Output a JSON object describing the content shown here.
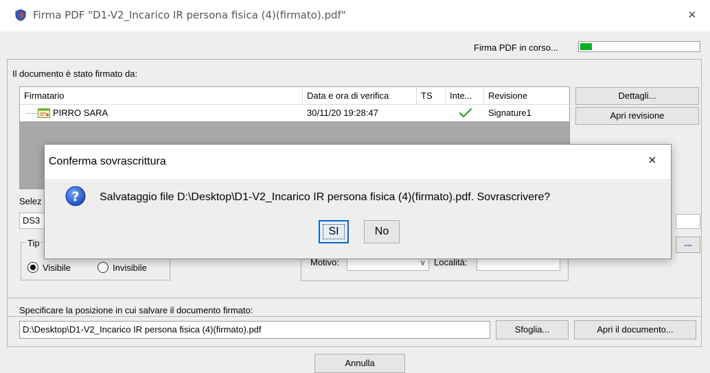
{
  "window": {
    "title": "Firma PDF \"D1-V2_Incarico IR persona fisica (4)(firmato).pdf\"",
    "close_glyph": "×",
    "app_icon": "shield-icon"
  },
  "progress": {
    "label": "Firma PDF in corso...",
    "value_fraction": 0.1,
    "color": "#06b025"
  },
  "signers": {
    "group_label": "Il documento è stato firmato da:",
    "columns": [
      "Firmatario",
      "Data e ora di verifica",
      "TS",
      "Inte...",
      "Revisione"
    ],
    "rows": [
      {
        "signer": "PIRRO SARA",
        "verified_at": "30/11/20 19:28:47",
        "ts": "",
        "integrity": "check-icon",
        "revision": "Signature1"
      }
    ],
    "details_button": "Dettagli...",
    "open_revision_button": "Apri revisione"
  },
  "selection": {
    "label_partial": "Selez",
    "value_partial": "DS3",
    "side_button": "..."
  },
  "signature_type": {
    "label_partial": "Tip",
    "options": [
      "Visibile",
      "Invisibile"
    ],
    "selected": "Visibile"
  },
  "reason": {
    "motivo_label": "Motivo:",
    "localita_label": "Località:"
  },
  "save": {
    "label": "Specificare la posizione in cui salvare il documento firmato:",
    "path": "D:\\Desktop\\D1-V2_Incarico IR persona fisica (4)(firmato).pdf",
    "browse_button": "Sfoglia...",
    "open_button": "Apri il documento...",
    "cancel_button": "Annulla"
  },
  "dialog": {
    "title": "Conferma sovrascrittura",
    "close_glyph": "×",
    "icon": "question-icon",
    "message": "Salvataggio file D:\\Desktop\\D1-V2_Incarico IR persona fisica (4)(firmato).pdf. Sovrascrivere?",
    "yes_button": "SI",
    "no_button": "No"
  }
}
